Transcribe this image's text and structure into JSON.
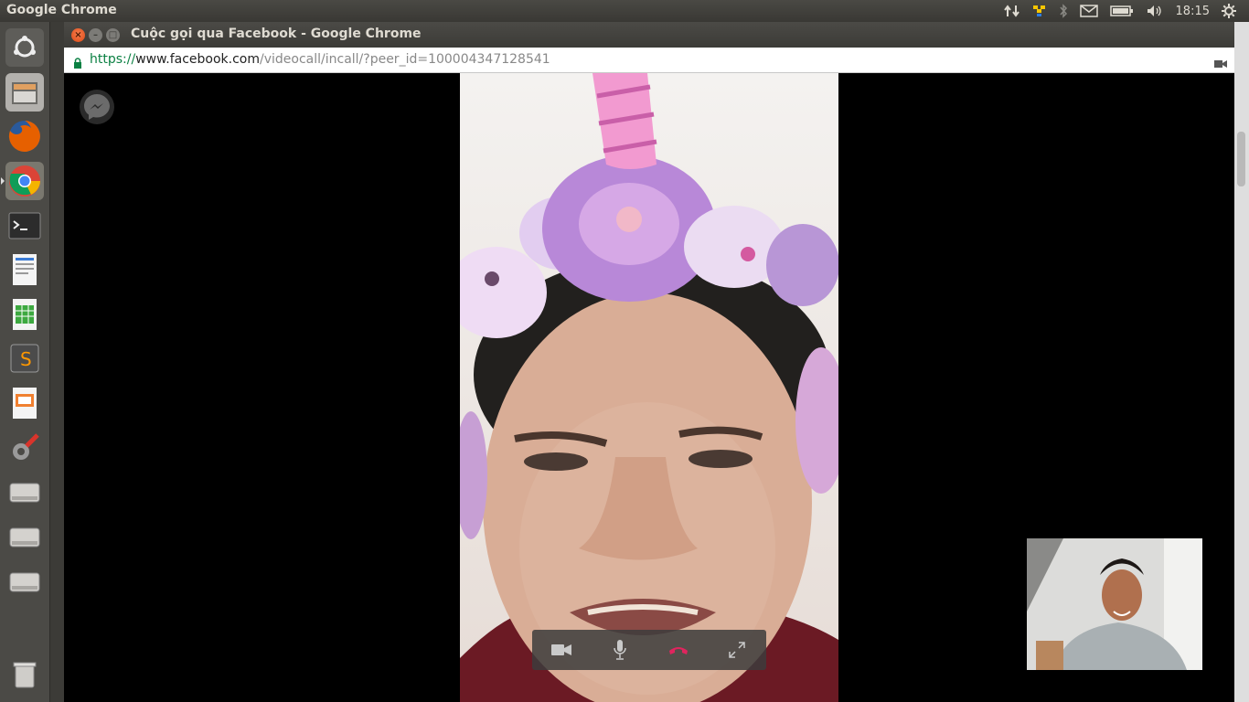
{
  "top_panel": {
    "app_name": "Google Chrome",
    "clock": "18:15",
    "tray_icons": [
      "network-transfer-icon",
      "dropbox-icon",
      "bluetooth-icon",
      "mail-icon",
      "battery-icon",
      "volume-icon",
      "settings-gear-icon"
    ]
  },
  "launcher": {
    "items": [
      "ubuntu-dash-icon",
      "files-icon",
      "firefox-icon",
      "chrome-icon",
      "terminal-icon",
      "writer-icon",
      "calc-icon",
      "sublime-text-icon",
      "impress-icon",
      "system-settings-icon",
      "drive-icon",
      "drive-icon",
      "drive-icon",
      "trash-icon"
    ]
  },
  "window": {
    "title": "Cuộc gọi qua Facebook - Google Chrome"
  },
  "address": {
    "scheme": "https://",
    "host": "www.facebook.com",
    "path": "/videocall/incall/?peer_id=100004347128541"
  },
  "call": {
    "controls": [
      "video-camera-icon",
      "microphone-icon",
      "end-call-icon",
      "fullscreen-icon"
    ],
    "colors": {
      "end_call": "#e0245e",
      "controls_bg": "#3c3c3c"
    }
  }
}
